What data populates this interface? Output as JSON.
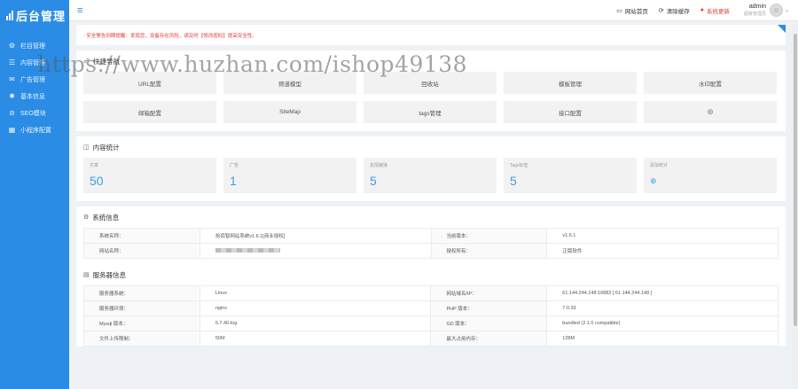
{
  "sidebar": {
    "logo": "后台管理",
    "items": [
      {
        "icon": "gear-icon",
        "glyph": "⚙",
        "label": "栏目管理"
      },
      {
        "icon": "document-icon",
        "glyph": "☰",
        "label": "内容管理"
      },
      {
        "icon": "megaphone-icon",
        "glyph": "✉",
        "label": "广告管理"
      },
      {
        "icon": "settings-icon",
        "glyph": "✹",
        "label": "基本信息"
      },
      {
        "icon": "seo-icon",
        "glyph": "⊘",
        "label": "SEO模块"
      },
      {
        "icon": "grid-icon",
        "glyph": "▦",
        "label": "小程序配置"
      }
    ]
  },
  "header": {
    "menu_glyph": "≡",
    "site_home": "网站首页",
    "clear_cache": "清除缓存",
    "system_update": "系统更新",
    "username": "admin",
    "role": "超级管理员"
  },
  "notice": "· 安全警告到期提醒：发现您，设备存在风险，请及时【修改密码】提高安全性。",
  "watermark": "https://www.huzhan.com/ishop49138",
  "shortcuts": {
    "title": "快捷导航",
    "items": [
      "URL配置",
      "频道模型",
      "回收站",
      "模板管理",
      "水印配置",
      "邮箱配置",
      "SiteMap",
      "tags管理",
      "接口配置",
      "⊕"
    ]
  },
  "stats": {
    "title": "内容统计",
    "items": [
      {
        "label": "文章",
        "value": "50"
      },
      {
        "label": "广告",
        "value": "1"
      },
      {
        "label": "友情链接",
        "value": "5"
      },
      {
        "label": "Tags标签",
        "value": "5"
      },
      {
        "label": "添加统计",
        "value": "⊕"
      }
    ]
  },
  "system": {
    "title": "系统信息",
    "rows": [
      {
        "k1": "系统名称：",
        "v1": "拾佰智网站系统v1.6.1[商业授权]",
        "k2": "当前版本：",
        "v2": "v1.6.1"
      },
      {
        "k1": "网站名称：",
        "v1": "",
        "k2": "授权所有：",
        "v2": "正版软件"
      }
    ]
  },
  "server": {
    "title": "服务器信息",
    "rows": [
      {
        "k1": "服务器系统：",
        "v1": "Linux",
        "k2": "网站域名/IP：",
        "v2": "61.144.244.148:16883 [ 61.144.244.148 ]"
      },
      {
        "k1": "服务器环境：",
        "v1": "nginx",
        "k2": "PHP 版本：",
        "v2": "7.0.33"
      },
      {
        "k1": "Mysql 版本：",
        "v1": "5.7.40-log",
        "k2": "GD 版本：",
        "v2": "bundled (2.1.0 compatible)"
      },
      {
        "k1": "文件上传限制：",
        "v1": "50M",
        "k2": "最大占用内存：",
        "v2": "128M"
      }
    ]
  },
  "colors": {
    "sidebar": "#2a8ce5",
    "accent": "#3fa1d9",
    "danger": "#e53935"
  }
}
